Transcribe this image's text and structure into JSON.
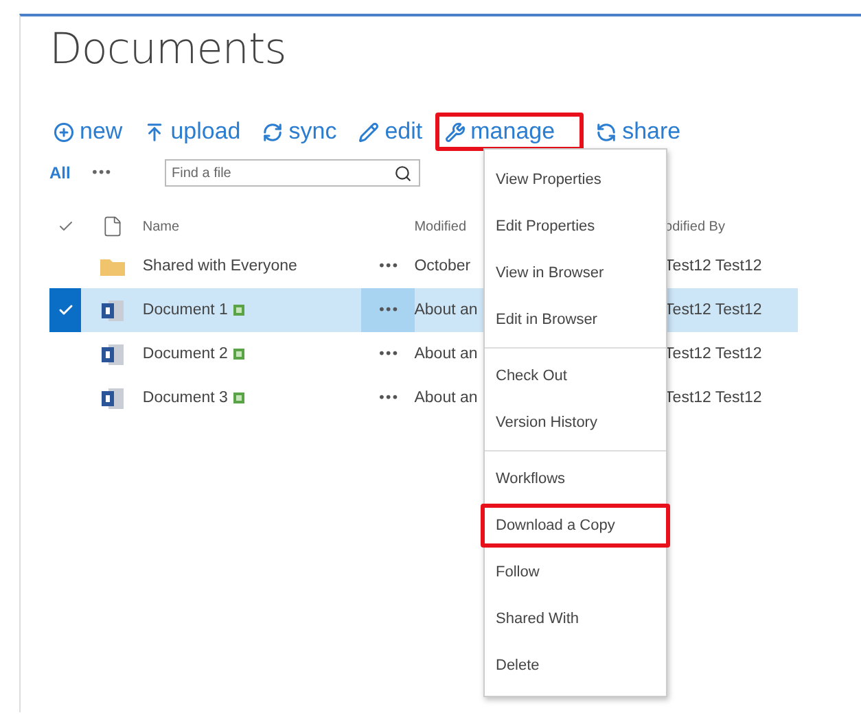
{
  "title": "Documents",
  "toolbar": [
    {
      "label": "new",
      "highlighted": false
    },
    {
      "label": "upload",
      "highlighted": false
    },
    {
      "label": "sync",
      "highlighted": false
    },
    {
      "label": "edit",
      "highlighted": false
    },
    {
      "label": "manage",
      "highlighted": true
    },
    {
      "label": "share",
      "highlighted": false
    }
  ],
  "views": {
    "current": "All",
    "more": "•••"
  },
  "search": {
    "placeholder": "Find a file"
  },
  "table": {
    "columns": [
      "Name",
      "Modified",
      "odified By"
    ],
    "rows": [
      {
        "kind": "folder",
        "name": "Shared with Everyone",
        "is_new": false,
        "selected": false,
        "more": "•••",
        "modified": "October",
        "modified_by": "Test12 Test12"
      },
      {
        "kind": "document",
        "name": "Document 1",
        "is_new": true,
        "selected": true,
        "more": "•••",
        "modified": "About an",
        "modified_by": "Test12 Test12"
      },
      {
        "kind": "document",
        "name": "Document 2",
        "is_new": true,
        "selected": false,
        "more": "•••",
        "modified": "About an",
        "modified_by": "Test12 Test12"
      },
      {
        "kind": "document",
        "name": "Document 3",
        "is_new": true,
        "selected": false,
        "more": "•••",
        "modified": "About an",
        "modified_by": "Test12 Test12"
      }
    ]
  },
  "menu": {
    "groups": [
      [
        {
          "label": "View Properties",
          "highlighted": false
        },
        {
          "label": "Edit Properties",
          "highlighted": false
        },
        {
          "label": "View in Browser",
          "highlighted": false
        },
        {
          "label": "Edit in Browser",
          "highlighted": false
        }
      ],
      [
        {
          "label": "Check Out",
          "highlighted": false
        },
        {
          "label": "Version History",
          "highlighted": false
        }
      ],
      [
        {
          "label": "Workflows",
          "highlighted": false
        },
        {
          "label": "Download a Copy",
          "highlighted": true
        },
        {
          "label": "Follow",
          "highlighted": false
        },
        {
          "label": "Shared With",
          "highlighted": false
        },
        {
          "label": "Delete",
          "highlighted": false
        }
      ]
    ]
  }
}
